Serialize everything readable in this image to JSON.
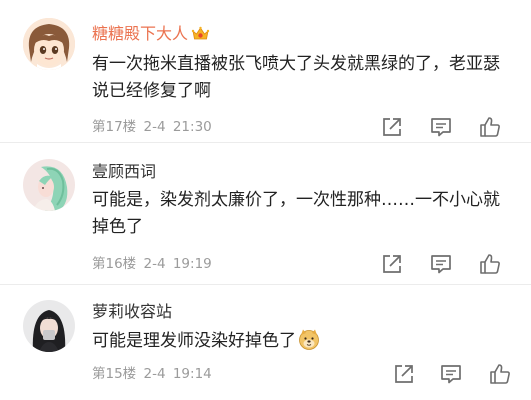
{
  "comments": [
    {
      "username": "糖糖殿下大人",
      "text": "有一次拖米直播被张飞喷大了头发就黑绿的了，老亚瑟说已经修复了啊",
      "floor": "第17楼",
      "date": "2-4",
      "time": "21:30",
      "avatar_icon": "anime-girl-avatar",
      "badge_icon": "vip-crown-badge-icon",
      "name_color": "#eb7350"
    },
    {
      "username": "壹顾西词",
      "text": "可能是，染发剂太廉价了，一次性那种……一不小心就掉色了",
      "floor": "第16楼",
      "date": "2-4",
      "time": "19:19",
      "avatar_icon": "green-hair-girl-avatar"
    },
    {
      "username": "萝莉收容站",
      "text": "可能是理发师没染好掉色了",
      "floor": "第15楼",
      "date": "2-4",
      "time": "19:14",
      "avatar_icon": "dark-hair-photo-avatar",
      "emoji_icon": "doge-emoji-icon"
    }
  ],
  "icons": {
    "share": "share-icon",
    "comment": "comment-icon",
    "like": "thumbs-up-icon"
  },
  "colors": {
    "vip_name": "#eb7350",
    "meta_text": "#9b9b9b",
    "icon_gray": "#6e6e6e"
  }
}
